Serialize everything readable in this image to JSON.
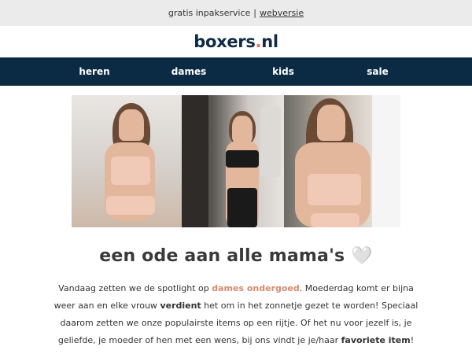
{
  "topbar": {
    "text": "gratis inpakservice",
    "separator": "|",
    "link_label": "webversie"
  },
  "logo": {
    "part1": "boxers",
    "dot": ".",
    "part2": "nl"
  },
  "nav": {
    "items": [
      {
        "label": "heren"
      },
      {
        "label": "dames"
      },
      {
        "label": "kids"
      },
      {
        "label": "sale"
      }
    ]
  },
  "hero": {
    "heading": "een ode aan alle mama's 🤍"
  },
  "body": {
    "s1": "Vandaag zetten we de spotlight op ",
    "link1": "dames ondergoed",
    "s2": ". Moederdag komt er bijna weer aan en elke vrouw ",
    "bold1": "verdient",
    "s3": " het om in het zonnetje gezet te worden! Speciaal daarom zetten we onze populairste items op een rijtje. Of het nu voor jezelf is, je geliefde, je moeder of hen met een wens, bij ons vindt je je/haar ",
    "bold2": "favoriete item",
    "s4": "!"
  },
  "colors": {
    "nav_bg": "#0b2a44",
    "accent": "#d88a6c",
    "logo": "#0e2a44",
    "topbar_bg": "#ebebeb"
  }
}
